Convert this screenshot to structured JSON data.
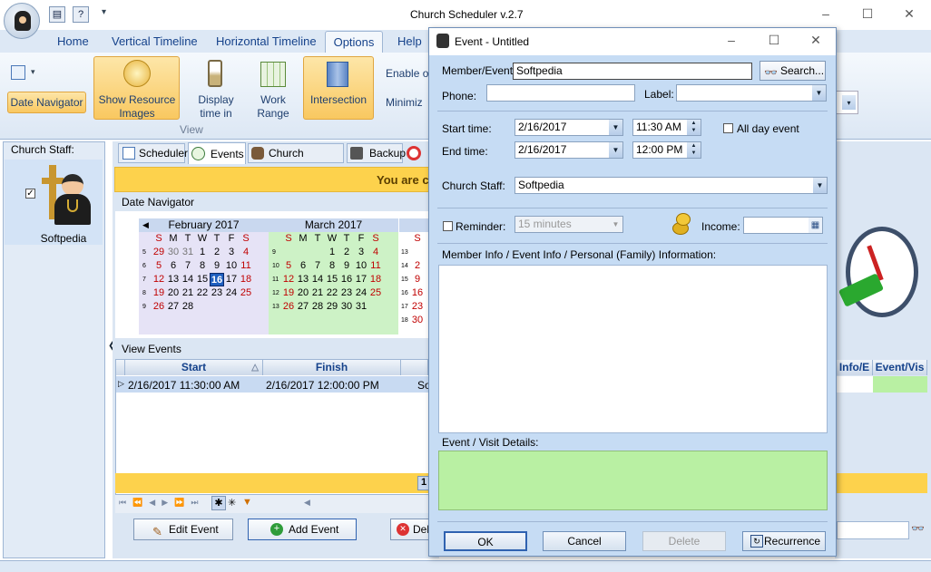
{
  "window": {
    "title": "Church Scheduler v.2.7"
  },
  "ribbon": {
    "tabs": [
      "Home",
      "Vertical Timeline",
      "Horizontal Timeline",
      "Options",
      "Help"
    ],
    "active_tab": "Options",
    "date_navigator": "Date Navigator",
    "show_resource_images": "Show Resource Images",
    "display_time_in": "Display time in",
    "work_range": "Work Range",
    "intersection": "Intersection",
    "group_view": "View",
    "enable_label": "Enable o",
    "minimize_label": "Minimiz"
  },
  "staff": {
    "header": "Church Staff:",
    "member_name": "Softpedia"
  },
  "main": {
    "tabs": [
      "Scheduler",
      "Events",
      "Church Members",
      "Backup"
    ],
    "banner": "You are c",
    "date_navigator_label": "Date Navigator",
    "feb": {
      "title": "February 2017",
      "weekdays": [
        "S",
        "M",
        "T",
        "W",
        "T",
        "F",
        "S"
      ],
      "weeks": [
        {
          "wk": "5",
          "days": [
            "29",
            "30",
            "31",
            "1",
            "2",
            "3",
            "4"
          ]
        },
        {
          "wk": "6",
          "days": [
            "5",
            "6",
            "7",
            "8",
            "9",
            "10",
            "11"
          ]
        },
        {
          "wk": "7",
          "days": [
            "12",
            "13",
            "14",
            "15",
            "16",
            "17",
            "18"
          ]
        },
        {
          "wk": "8",
          "days": [
            "19",
            "20",
            "21",
            "22",
            "23",
            "24",
            "25"
          ]
        },
        {
          "wk": "9",
          "days": [
            "26",
            "27",
            "28",
            "",
            "",
            "",
            ""
          ]
        }
      ]
    },
    "mar": {
      "title": "March 2017",
      "weekdays": [
        "S",
        "M",
        "T",
        "W",
        "T",
        "F",
        "S"
      ],
      "weeks": [
        {
          "wk": "9",
          "days": [
            "",
            "",
            "",
            "1",
            "2",
            "3",
            "4"
          ]
        },
        {
          "wk": "10",
          "days": [
            "5",
            "6",
            "7",
            "8",
            "9",
            "10",
            "11"
          ]
        },
        {
          "wk": "11",
          "days": [
            "12",
            "13",
            "14",
            "15",
            "16",
            "17",
            "18"
          ]
        },
        {
          "wk": "12",
          "days": [
            "19",
            "20",
            "21",
            "22",
            "23",
            "24",
            "25"
          ]
        },
        {
          "wk": "13",
          "days": [
            "26",
            "27",
            "28",
            "29",
            "30",
            "31",
            ""
          ]
        }
      ]
    },
    "apr_partial": {
      "weekday": "S",
      "weeks": [
        {
          "wk": "13",
          "day": ""
        },
        {
          "wk": "14",
          "day": "2"
        },
        {
          "wk": "15",
          "day": "9"
        },
        {
          "wk": "16",
          "day": "16"
        },
        {
          "wk": "17",
          "day": "23"
        },
        {
          "wk": "18",
          "day": "30"
        }
      ]
    },
    "view_events_label": "View Events",
    "grid": {
      "headers": [
        "Start",
        "Finish"
      ],
      "row": {
        "start": "2/16/2017 11:30:00 AM",
        "finish": "2/16/2017 12:00:00 PM",
        "extra": "So"
      }
    },
    "right_headers": [
      "Info/E",
      "Event/Vis"
    ],
    "page_num": "1",
    "buttons": {
      "edit": "Edit Event",
      "add": "Add Event",
      "delete": "Del"
    }
  },
  "dialog": {
    "title": "Event - Untitled",
    "member_event_label": "Member/Event:",
    "member_event_value": "Softpedia",
    "search_label": "Search...",
    "phone_label": "Phone:",
    "phone_value": "",
    "label_label": "Label:",
    "start_time_label": "Start time:",
    "start_date": "2/16/2017",
    "start_time": "11:30 AM",
    "all_day_label": "All day event",
    "end_time_label": "End time:",
    "end_date": "2/16/2017",
    "end_time": "12:00 PM",
    "church_staff_label": "Church Staff:",
    "church_staff_value": "Softpedia",
    "reminder_label": "Reminder:",
    "reminder_value": "15 minutes",
    "income_label": "Income:",
    "info_label": "Member Info / Event Info / Personal (Family) Information:",
    "details_label": "Event / Visit Details:",
    "ok": "OK",
    "cancel": "Cancel",
    "delete": "Delete",
    "recurrence": "Recurrence"
  },
  "colors": {
    "ribbon_text": "#15428b",
    "banner": "#fdd24c",
    "highlight": "#f9c860",
    "details_bg": "#b9f0a3",
    "march_bg": "#cdf2c6"
  }
}
